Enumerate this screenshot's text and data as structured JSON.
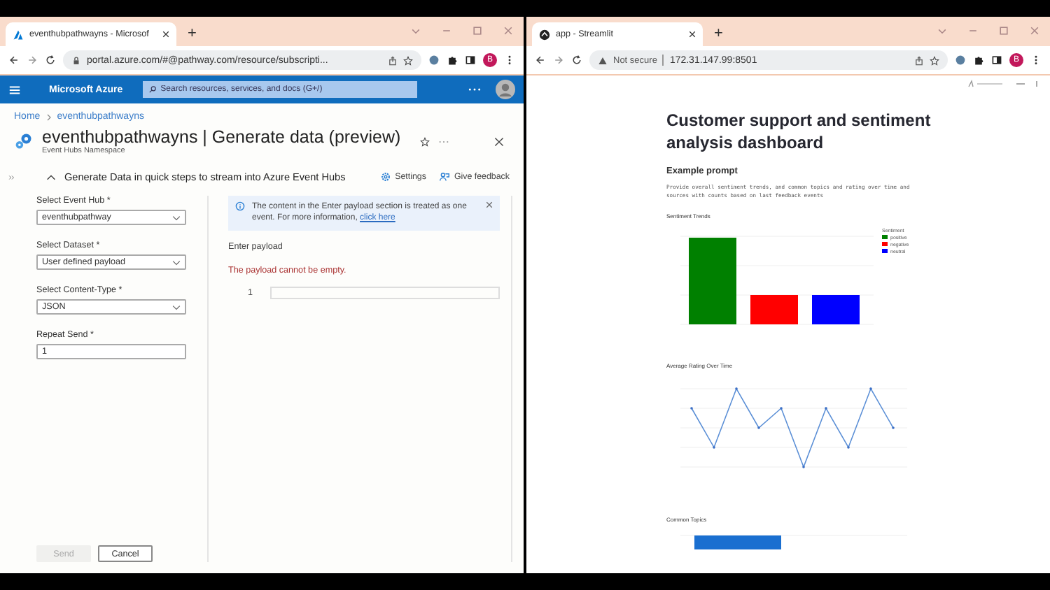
{
  "windows": [
    {
      "kind": "azure",
      "tab_title": "eventhubpathwayns - Microsof",
      "new_tab": "+",
      "url": "portal.azure.com/#@pathway.com/resource/subscripti...",
      "profile": "B"
    },
    {
      "kind": "streamlit",
      "tab_title": "app - Streamlit",
      "new_tab": "+",
      "security": "Not secure",
      "url": "172.31.147.99:8501",
      "profile": "B"
    }
  ],
  "azure": {
    "brand": "Microsoft Azure",
    "search": {
      "placeholder": "Search resources, services, and docs (G+/)"
    },
    "breadcrumb": [
      "Home",
      "eventhubpathwayns"
    ],
    "title": "eventhubpathwayns | Generate data (preview)",
    "subtitle": "Event Hubs Namespace",
    "section": "Generate Data in quick steps to stream into Azure Event Hubs",
    "actions": [
      {
        "kind": "settings",
        "label": "Settings"
      },
      {
        "kind": "feedback",
        "label": "Give feedback"
      }
    ],
    "fields": [
      {
        "kind": "select",
        "label": "Select Event Hub *",
        "value": "eventhubpathway"
      },
      {
        "kind": "select",
        "label": "Select Dataset *",
        "value": "User defined payload"
      },
      {
        "kind": "select",
        "label": "Select Content-Type *",
        "value": "JSON"
      },
      {
        "kind": "input",
        "label": "Repeat Send *",
        "value": "1"
      }
    ],
    "info": {
      "text": "The content in the Enter payload section is treated as one event. For more information, ",
      "link": "click here"
    },
    "payload_label": "Enter payload",
    "payload_error": "The payload cannot be empty.",
    "line_number": "1",
    "buttons": [
      {
        "label": "Send",
        "disabled": true
      },
      {
        "label": "Cancel",
        "disabled": false
      }
    ]
  },
  "streamlit": {
    "title": "Customer support and sentiment analysis dashboard",
    "prompt_heading": "Example prompt",
    "prompt": "Provide overall sentiment trends, and common topics and rating over time and sources with counts based on last feedback events",
    "charts": [
      {
        "kind": "bars",
        "title": "Sentiment Trends",
        "legend_title": "Sentiment",
        "legend": [
          {
            "label": "positive",
            "color": "#008000"
          },
          {
            "label": "negative",
            "color": "#ff0000"
          },
          {
            "label": "neutral",
            "color": "#0000ff"
          }
        ]
      },
      {
        "kind": "line",
        "title": "Average Rating Over Time"
      },
      {
        "kind": "topics",
        "title": "Common Topics"
      }
    ]
  }
}
